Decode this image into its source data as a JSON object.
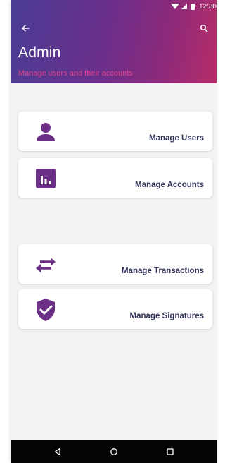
{
  "status_bar": {
    "time": "12:30"
  },
  "header": {
    "title": "Admin",
    "subtitle": "Manage users and their accounts"
  },
  "menu": {
    "items": [
      {
        "label": "Manage Users",
        "icon": "user-icon"
      },
      {
        "label": "Manage Accounts",
        "icon": "bar-chart-icon"
      },
      {
        "label": "Manage Transactions",
        "icon": "swap-arrows-icon"
      },
      {
        "label": "Manage Signatures",
        "icon": "shield-check-icon"
      }
    ]
  },
  "colors": {
    "icon_purple": "#6b2f86",
    "label_text": "#34375c",
    "subtitle_pink": "#e0458a"
  }
}
